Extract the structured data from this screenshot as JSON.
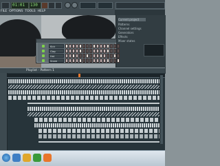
{
  "toolbar": {
    "menu": [
      "FILE",
      "OPTIONS",
      "TOOLS",
      "HELP"
    ],
    "tempo": "130",
    "time": "01:01"
  },
  "browser": {
    "items": [
      "Current project",
      "Patterns",
      "Channel settings",
      "Generators",
      "Effects",
      "Mixer states"
    ]
  },
  "step_sequencer": {
    "title": "",
    "channels": [
      {
        "name": "Kick",
        "steps": [
          1,
          0,
          0,
          0,
          1,
          0,
          0,
          0,
          1,
          0,
          0,
          0,
          1,
          0,
          0,
          0
        ]
      },
      {
        "name": "Clap",
        "steps": [
          0,
          0,
          0,
          0,
          1,
          0,
          0,
          0,
          0,
          0,
          0,
          0,
          1,
          0,
          0,
          0
        ]
      },
      {
        "name": "Hat",
        "steps": [
          0,
          0,
          1,
          0,
          0,
          0,
          1,
          0,
          0,
          0,
          1,
          0,
          0,
          0,
          1,
          0
        ]
      },
      {
        "name": "Snare",
        "steps": [
          0,
          0,
          0,
          0,
          1,
          0,
          0,
          0,
          0,
          0,
          0,
          0,
          1,
          0,
          0,
          1
        ]
      }
    ]
  },
  "playlist": {
    "title": "Playlist - Pattern 1"
  },
  "taskbar": {
    "label": ""
  },
  "colors": {
    "accent": "#e8762b",
    "led": "#7ed14c"
  }
}
